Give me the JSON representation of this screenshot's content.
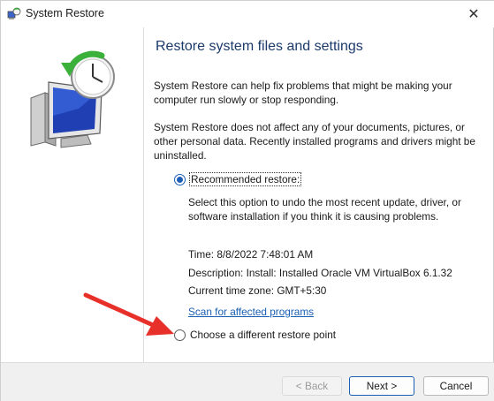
{
  "window": {
    "title": "System Restore",
    "close_glyph": "✕",
    "app_icon": "system-restore-icon"
  },
  "content": {
    "heading": "Restore system files and settings",
    "intro": "System Restore can help fix problems that might be making your computer run slowly or stop responding.",
    "notice": "System Restore does not affect any of your documents, pictures, or other personal data. Recently installed programs and drivers might be uninstalled."
  },
  "options": {
    "recommended": {
      "label": "Recommended restore:",
      "selected": true,
      "description": "Select this option to undo the most recent update, driver, or software installation if you think it is causing problems."
    },
    "restore_point": {
      "time": "Time: 8/8/2022 7:48:01 AM",
      "description": "Description: Install: Installed Oracle VM VirtualBox 6.1.32",
      "timezone": "Current time zone: GMT+5:30"
    },
    "scan_link": "Scan for affected programs",
    "different": {
      "label": "Choose a different restore point",
      "selected": false
    }
  },
  "footer": {
    "back_label": "< Back",
    "next_label": "Next >",
    "cancel_label": "Cancel"
  },
  "annotation": {
    "arrow_color": "#e8302a"
  }
}
